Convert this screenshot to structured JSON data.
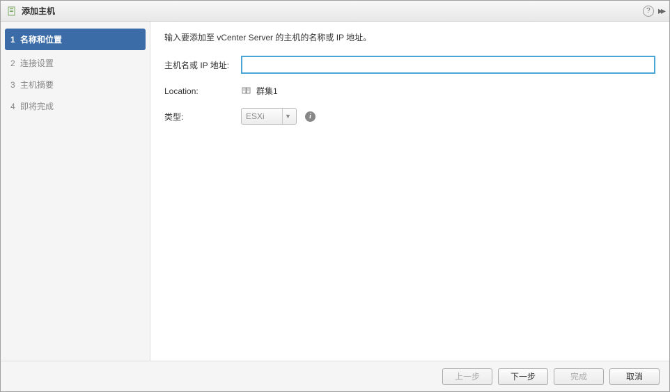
{
  "titlebar": {
    "title": "添加主机"
  },
  "sidebar": {
    "steps": [
      {
        "num": "1",
        "label": "名称和位置"
      },
      {
        "num": "2",
        "label": "连接设置"
      },
      {
        "num": "3",
        "label": "主机摘要"
      },
      {
        "num": "4",
        "label": "即将完成"
      }
    ]
  },
  "main": {
    "instruction": "输入要添加至 vCenter Server 的主机的名称或 IP 地址。",
    "hostname_label": "主机名或 IP 地址:",
    "hostname_value": "",
    "location_label": "Location:",
    "location_value": "群集1",
    "type_label": "类型:",
    "type_value": "ESXi"
  },
  "footer": {
    "back": "上一步",
    "next": "下一步",
    "finish": "完成",
    "cancel": "取消"
  }
}
